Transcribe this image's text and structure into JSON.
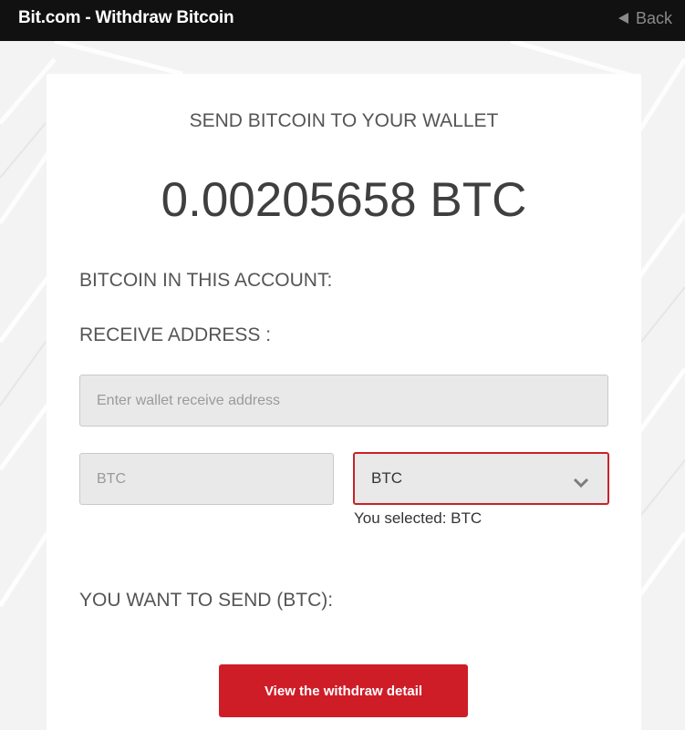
{
  "header": {
    "title": "Bit.com - Withdraw Bitcoin",
    "back_label": "Back",
    "back_icon": "left-triangle-icon"
  },
  "card": {
    "title": "SEND BITCOIN TO YOUR WALLET",
    "amount": "0.00205658 BTC",
    "account_label": "BITCOIN IN THIS ACCOUNT:",
    "receive_label": "RECEIVE ADDRESS :",
    "address_placeholder": "Enter wallet receive address",
    "currency_placeholder": "BTC",
    "currency_select": {
      "selected": "BTC",
      "icon": "chevron-down-icon"
    },
    "selected_note": "You selected: BTC",
    "send_label": "YOU WANT TO SEND (BTC):",
    "submit_label": "View the withdraw detail"
  },
  "colors": {
    "topbar": "#111111",
    "accent": "#cf1d28",
    "input_bg": "#e9e9e9",
    "page_bg": "#f3f3f3"
  }
}
